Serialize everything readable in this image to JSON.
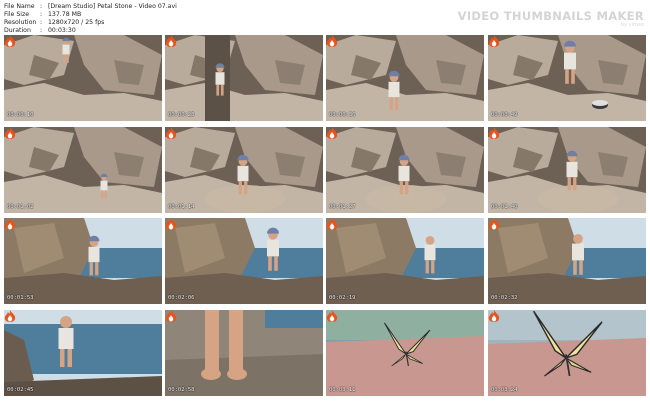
{
  "header": {
    "rows": [
      {
        "key": "File Name",
        "value": "[Dream Studio] Petal Stone - Video 07.avi"
      },
      {
        "key": "File Size",
        "value": "137.78 MB"
      },
      {
        "key": "Resolution",
        "value": "1280x720 / 25 fps"
      },
      {
        "key": "Duration",
        "value": "00:03:30"
      }
    ],
    "separator": ":",
    "brand": "VIDEO THUMBNAILS MAKER",
    "brand_site": "by vimeo"
  },
  "thumbnails": [
    {
      "time": "00:00:10",
      "scene": "rocks-figure-top"
    },
    {
      "time": "00:00:23",
      "scene": "rocks-figure-crevice"
    },
    {
      "time": "00:00:36",
      "scene": "rocks-figure-standing"
    },
    {
      "time": "00:00:49",
      "scene": "rocks-figure-bucket"
    },
    {
      "time": "00:01:02",
      "scene": "rocks-figure-crouch-small"
    },
    {
      "time": "00:01:14",
      "scene": "rocks-figure-crouch"
    },
    {
      "time": "00:01:27",
      "scene": "rocks-figure-crouch"
    },
    {
      "time": "00:01:40",
      "scene": "rocks-figure-crouch-right"
    },
    {
      "time": "00:01:53",
      "scene": "cliff-sea-figure"
    },
    {
      "time": "00:02:06",
      "scene": "cliff-sea-figure-hat"
    },
    {
      "time": "00:02:19",
      "scene": "cliff-sea-figure-walk"
    },
    {
      "time": "00:02:32",
      "scene": "cliff-sea-figure-right"
    },
    {
      "time": "00:02:45",
      "scene": "sea-rocks-figure"
    },
    {
      "time": "00:02:58",
      "scene": "legs-closeup"
    },
    {
      "time": "00:03:11",
      "scene": "butterfly-ground"
    },
    {
      "time": "00:03:24",
      "scene": "butterfly-closeup"
    }
  ],
  "colors": {
    "rock_light": "#b9ab9b",
    "rock_dark": "#6d6155",
    "sea": "#4f7d9c",
    "sky": "#cfdde6",
    "ground_pink": "#c89890",
    "skin": "#d6a484",
    "cap": "#6f7fa6"
  },
  "logo_icon": "flame-logo-icon"
}
